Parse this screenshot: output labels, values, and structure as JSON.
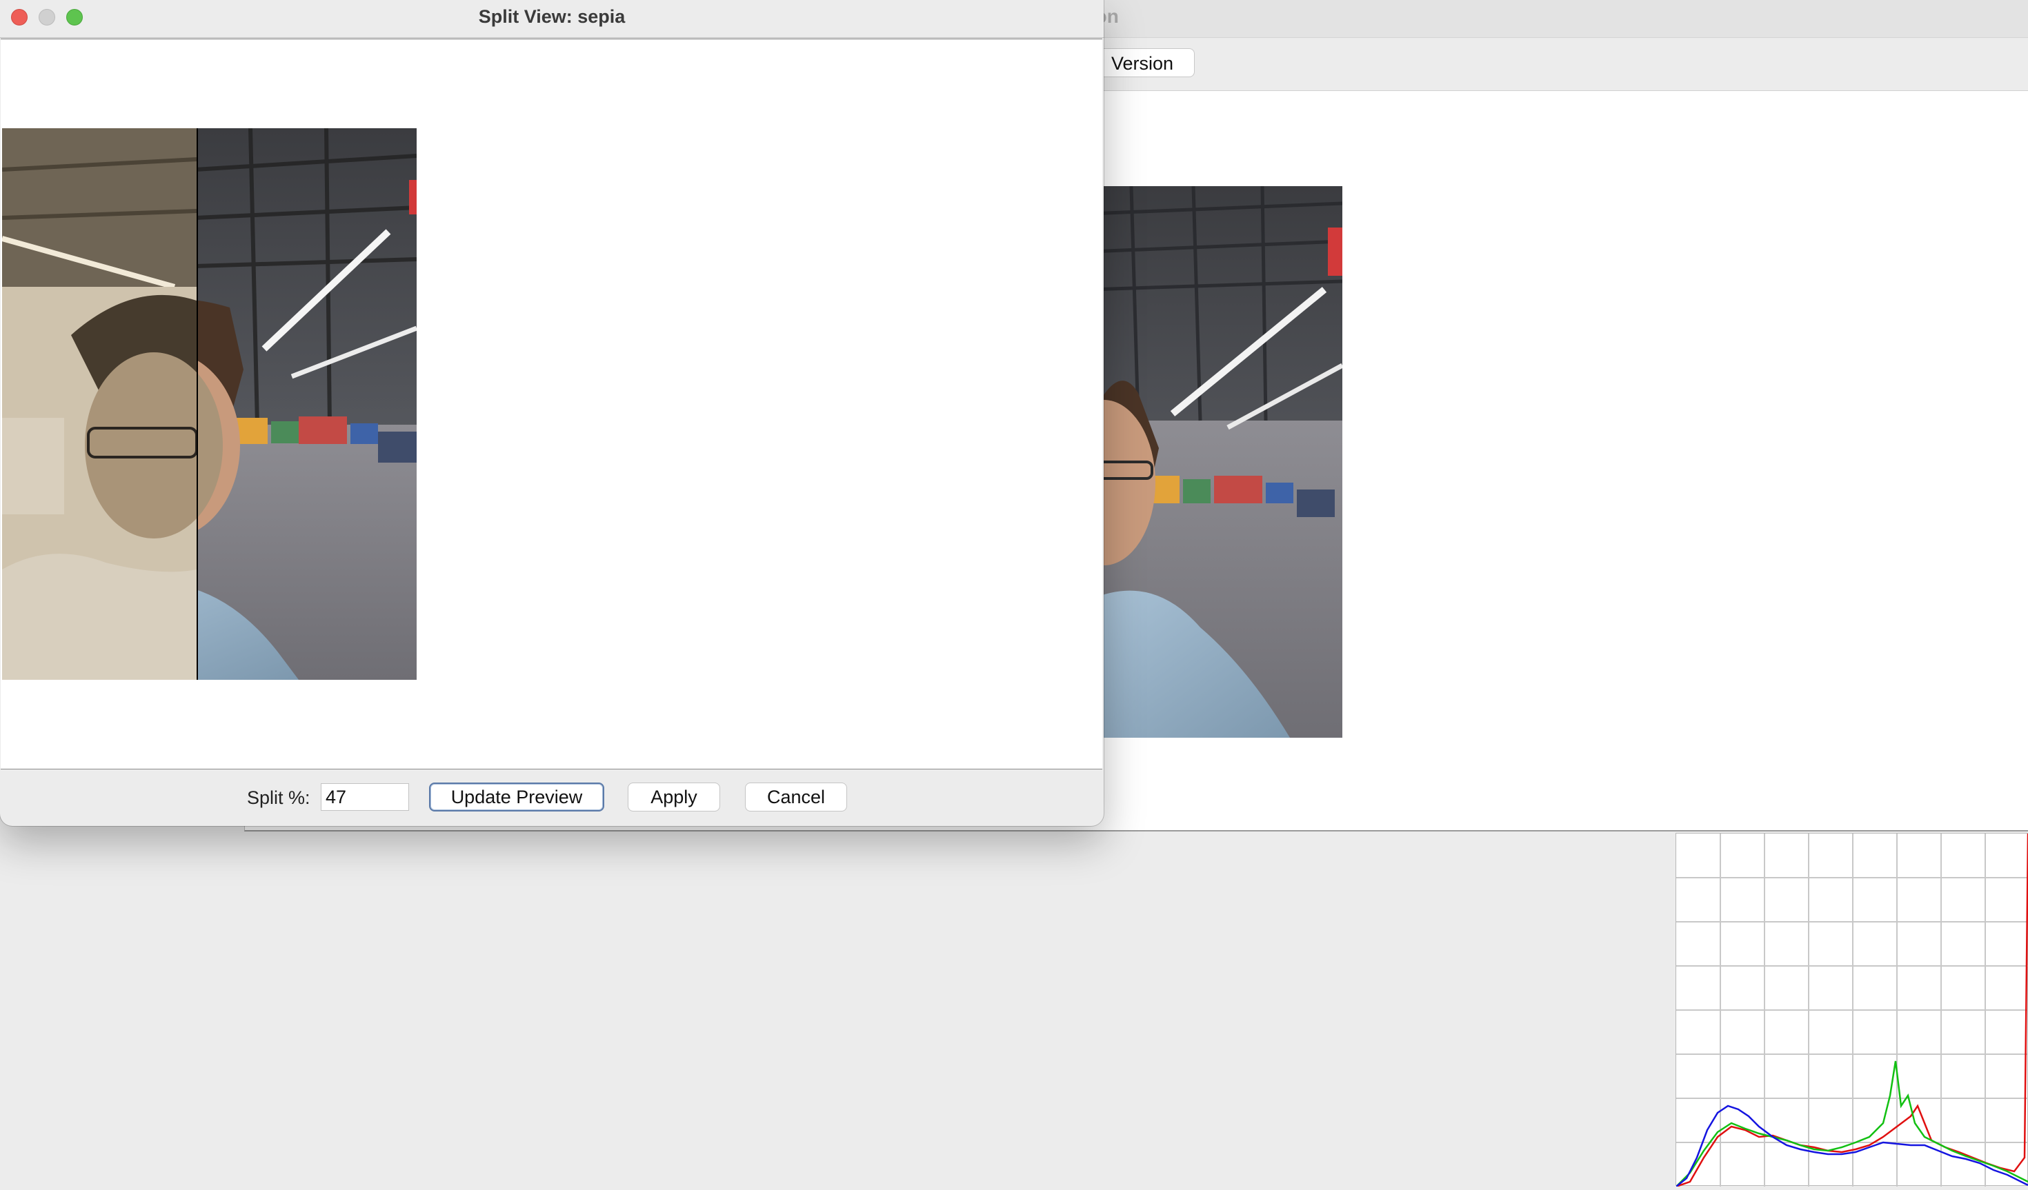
{
  "background_window": {
    "title_partial": "ation",
    "toolbar_button_partial": "Version"
  },
  "dialog": {
    "title": "Split View: sepia",
    "split_label": "Split %:",
    "split_value": "47",
    "update_button": "Update Preview",
    "apply_button": "Apply",
    "cancel_button": "Cancel"
  },
  "histogram": {
    "series_colors": [
      "#ff0000",
      "#00cc00",
      "#0000ff"
    ]
  }
}
